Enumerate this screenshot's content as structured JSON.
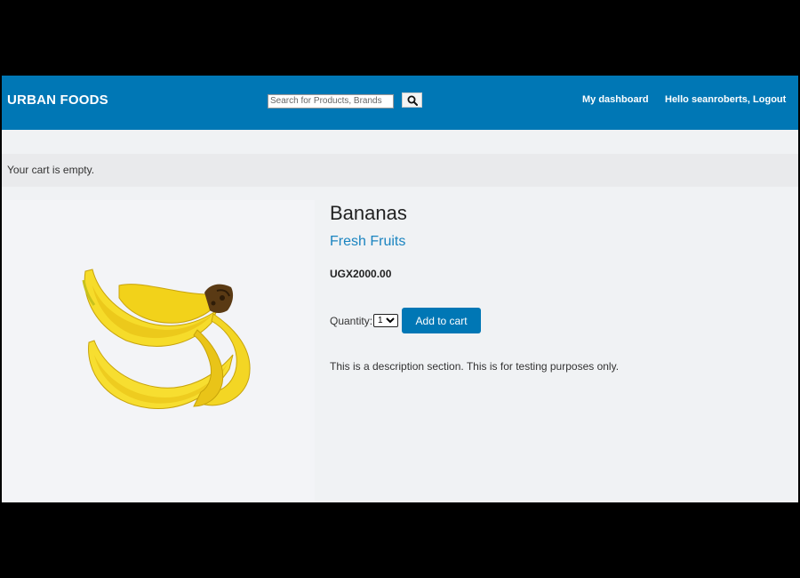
{
  "header": {
    "brand": "URBAN FOODS",
    "search_placeholder": "Search for Products, Brands",
    "search_icon": "search-icon",
    "nav": {
      "dashboard": "My dashboard",
      "greeting": "Hello seanroberts, Logout"
    },
    "colors": {
      "bar": "#0077b5",
      "text": "#ffffff"
    }
  },
  "cart": {
    "status": "Your cart is empty."
  },
  "product": {
    "name": "Bananas",
    "category": "Fresh Fruits",
    "price": "UGX2000.00",
    "quantity_label": "Quantity:",
    "quantity_selected": "1",
    "add_to_cart_label": "Add to cart",
    "description": "This is a description section. This is for testing purposes only.",
    "image_icon": "banana-image"
  }
}
